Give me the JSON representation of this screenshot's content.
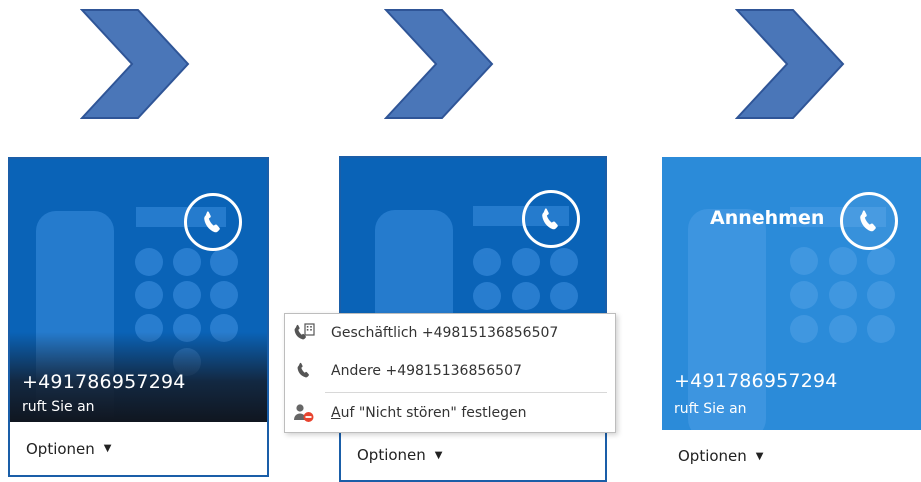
{
  "colors": {
    "arrow_fill": "#4a76b8",
    "arrow_stroke": "#2f5597",
    "toast_dark": "#0a63b7",
    "toast_light": "#2b8bd9",
    "menu_border": "#bdbdbd"
  },
  "toasts": [
    {
      "caller_number": "+491786957294",
      "caller_status": "ruft Sie an",
      "options_label": "Optionen"
    },
    {
      "options_label": "Optionen",
      "menu": {
        "items": [
          {
            "icon": "business-phone-icon",
            "label": "Geschäftlich +49815136856507"
          },
          {
            "icon": "phone-handset-icon",
            "label": "Andere +49815136856507"
          },
          {
            "icon": "do-not-disturb-icon",
            "label_prefix": "A",
            "label_rest": "uf \"Nicht stören\" festlegen"
          }
        ]
      }
    },
    {
      "accept_label": "Annehmen",
      "caller_number": "+491786957294",
      "caller_status": "ruft Sie an",
      "options_label": "Optionen"
    }
  ]
}
